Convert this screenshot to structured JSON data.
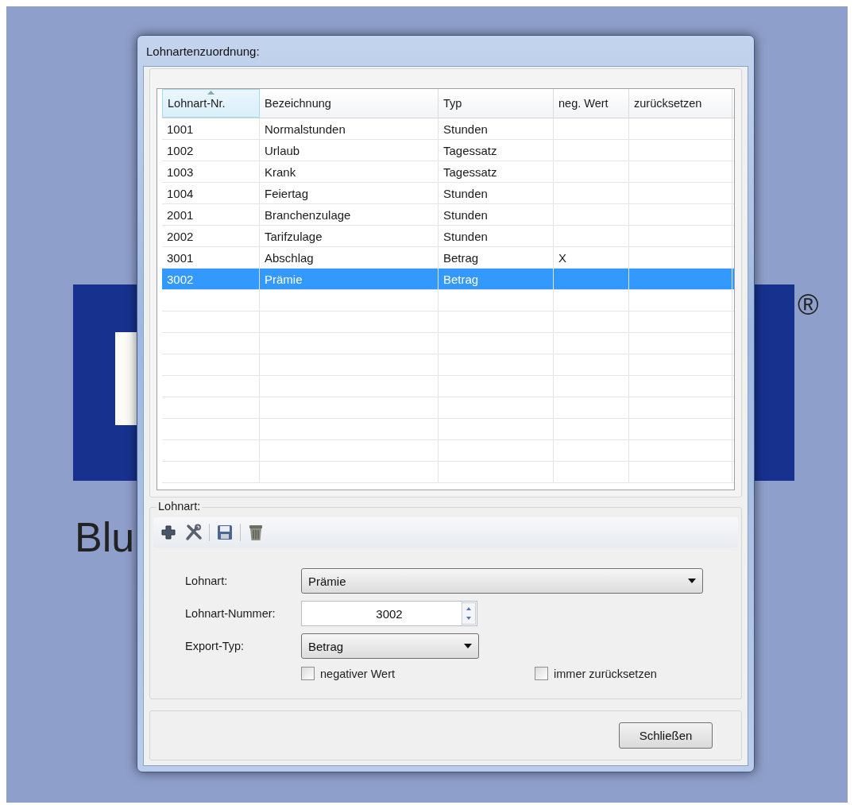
{
  "desktop": {
    "logo_text": "Blu",
    "trademark": "®"
  },
  "window": {
    "title": "Lohnartenzuordnung:"
  },
  "table": {
    "columns": [
      {
        "label": "Lohnart-Nr.",
        "sorted": true
      },
      {
        "label": "Bezeichnung"
      },
      {
        "label": "Typ"
      },
      {
        "label": "neg. Wert"
      },
      {
        "label": "zurücksetzen"
      }
    ],
    "rows": [
      {
        "cells": [
          "1001",
          "Normalstunden",
          "Stunden"
        ],
        "selected": false
      },
      {
        "cells": [
          "1002",
          "Urlaub",
          "Tagessatz"
        ],
        "selected": false
      },
      {
        "cells": [
          "1003",
          "Krank",
          "Tagessatz"
        ],
        "selected": false
      },
      {
        "cells": [
          "1004",
          "Feiertag",
          "Stunden"
        ],
        "selected": false
      },
      {
        "cells": [
          "2001",
          "Branchenzulage",
          "Stunden"
        ],
        "selected": false
      },
      {
        "cells": [
          "2002",
          "Tarifzulage",
          "Stunden"
        ],
        "selected": false
      },
      {
        "cells": [
          "3001",
          "Abschlag",
          "Betrag",
          "X"
        ],
        "selected": false
      },
      {
        "cells": [
          "3002",
          "Prämie",
          "Betrag"
        ],
        "selected": true
      }
    ]
  },
  "group": {
    "title": "Lohnart:",
    "toolbar": [
      {
        "kind": "add"
      },
      {
        "kind": "tools"
      },
      {
        "kind": "save"
      },
      {
        "kind": "delete"
      }
    ],
    "fields": [
      {
        "kind": "combo",
        "label": "Lohnart:",
        "value": "Prämie",
        "wide": true
      },
      {
        "kind": "spinner",
        "label": "Lohnart-Nummer:",
        "value": "3002"
      },
      {
        "kind": "combo",
        "label": "Export-Typ:",
        "value": "Betrag",
        "wide": false
      }
    ],
    "checkboxes": [
      {
        "label": "negativer Wert",
        "checked": false
      },
      {
        "label": "immer zurücksetzen",
        "checked": false
      }
    ]
  },
  "buttons": [
    "Schließen"
  ]
}
